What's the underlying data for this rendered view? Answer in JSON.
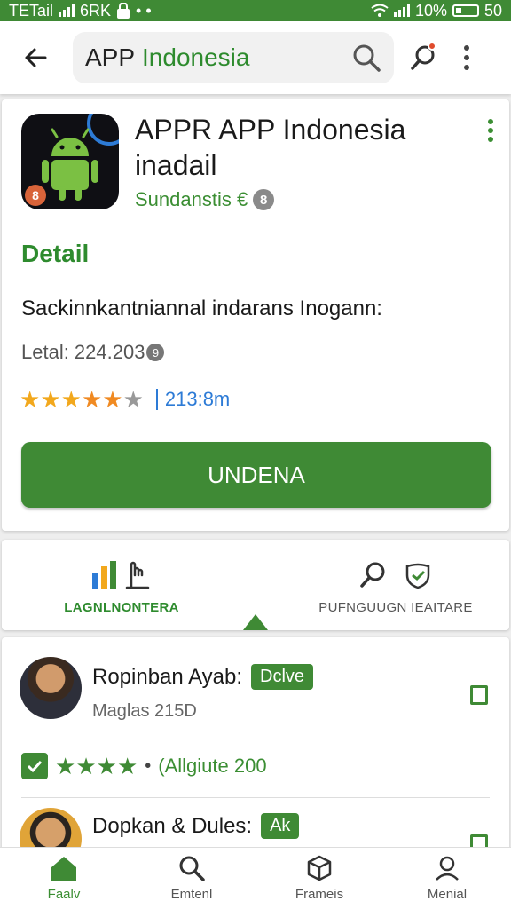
{
  "status_bar": {
    "carrier": "TETail",
    "carrier2": "6RK",
    "battery": "10%",
    "time": "50"
  },
  "header": {
    "search_query_part1": "APP",
    "search_query_part2": "Indonesia"
  },
  "app": {
    "title": "APPR APP Indonesia inadail",
    "developer": "Sundanstis €",
    "developer_badge": "8",
    "icon_badge": "8",
    "detail_heading": "Detail",
    "description": "Sackinnkantniannal indarans Inogann:",
    "meta": "Letal: 224.203",
    "meta_badge": "9",
    "rating_filled": 5,
    "rating_total": 6,
    "rating_count": "213:8m",
    "install_label": "UNDENA"
  },
  "tabs": {
    "left_label": "LAGNLNONTERA",
    "right_label": "PUFNGUUGN IEAITARE"
  },
  "reviews": [
    {
      "name": "Ropinban Ayab:",
      "chip": "Dclve",
      "subtitle": "Maglas 215D",
      "stars": 4,
      "count": "(Allgiute 200"
    },
    {
      "name": "Dopkan & Dules:",
      "chip": "Ak"
    }
  ],
  "bottom_nav": [
    {
      "label": "Faalv",
      "icon": "home-icon",
      "active": true
    },
    {
      "label": "Emtenl",
      "icon": "search-icon",
      "active": false
    },
    {
      "label": "Frameis",
      "icon": "cube-icon",
      "active": false
    },
    {
      "label": "Menial",
      "icon": "profile-icon",
      "active": false
    }
  ],
  "colors": {
    "accent": "#3f8a35",
    "link": "#2d7bd6",
    "star_gold": "#f2a81d",
    "star_orange": "#f08a22"
  }
}
